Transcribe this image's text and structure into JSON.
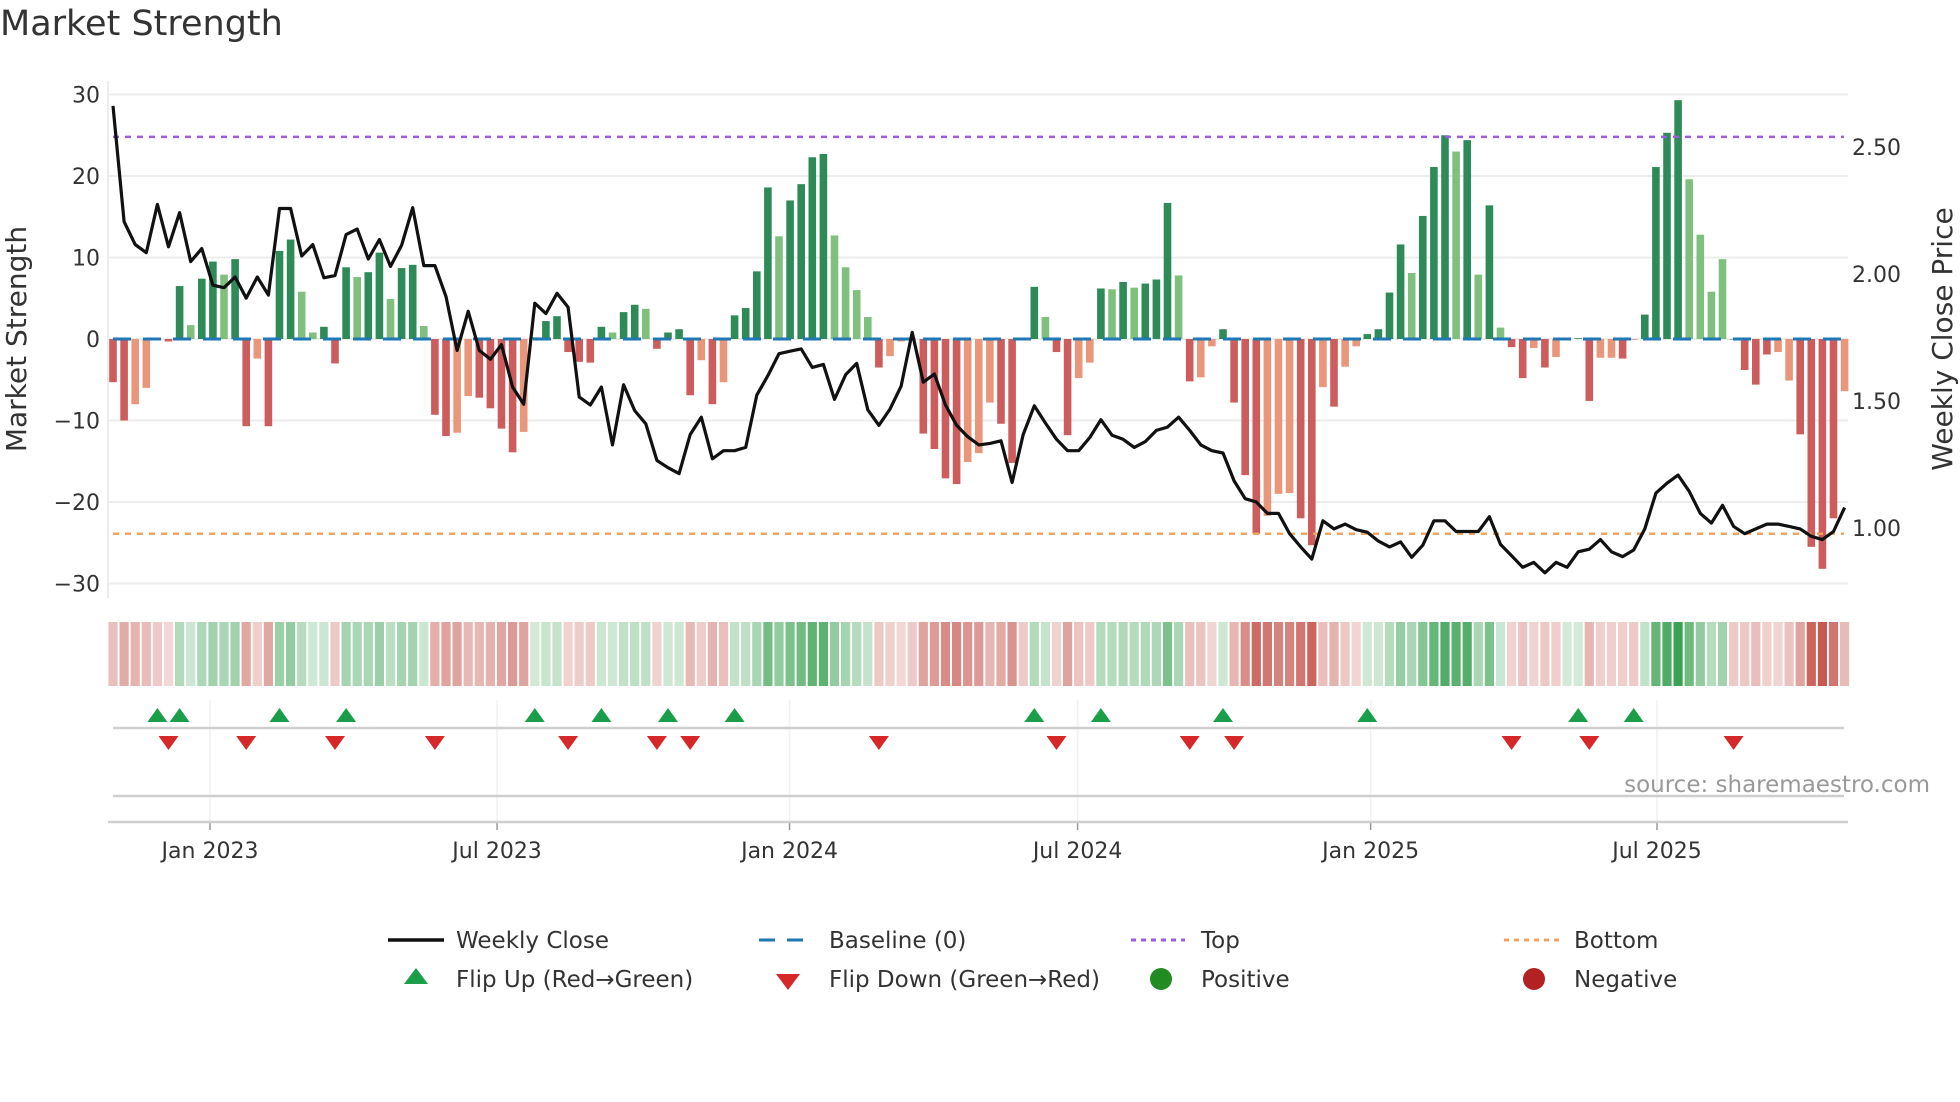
{
  "title": "Market Strength",
  "source": "source: sharemaestro.com",
  "legend": {
    "weekly_close": "Weekly Close",
    "baseline": "Baseline (0)",
    "top": "Top",
    "bottom": "Bottom",
    "flip_up": "Flip Up (Red→Green)",
    "flip_down": "Flip Down (Green→Red)",
    "positive": "Positive",
    "negative": "Negative"
  },
  "colors": {
    "strong_pos": "#2e8b57",
    "weak_pos": "#7fc07f",
    "strong_neg": "#cd5c5c",
    "weak_neg": "#e9967a",
    "price_line": "#111111",
    "baseline": "#1f77b4",
    "top": "#9b5de5",
    "bottom": "#f4a460",
    "flip_up": "#1a9e4a",
    "flip_down": "#d62828",
    "positive_dot": "#228b22",
    "negative_dot": "#b22222"
  },
  "chart_data": {
    "type": "bar+line",
    "title": "Market Strength",
    "ylabel": "Market Strength",
    "y2label": "Weekly Close Price",
    "ylim": [
      -31.5,
      31.5
    ],
    "yticks": [
      "30",
      "20",
      "10",
      "0",
      "−10",
      "−20",
      "−30"
    ],
    "ytick_values": [
      30,
      20,
      10,
      0,
      -10,
      -20,
      -30
    ],
    "y2ticks": [
      "2.50",
      "2.00",
      "1.50",
      "1.00"
    ],
    "y2tick_values": [
      2.5,
      2.0,
      1.5,
      1.0
    ],
    "xticks": [
      "Jan 2023",
      "Jul 2023",
      "Jan 2024",
      "Jul 2024",
      "Jan 2025",
      "Jul 2025"
    ],
    "xtick_week_index": [
      9.74,
      35.6,
      61.95,
      87.9,
      114.3,
      140.1
    ],
    "start_date": "2022-11-01",
    "interval": "weekly",
    "top_level": 24.8,
    "bottom_level": -23.9,
    "baseline": 0,
    "strength": [
      -5.3,
      -10,
      -8,
      -6,
      0,
      -0.3,
      6.5,
      1.7,
      7.4,
      9.5,
      7.9,
      9.8,
      -10.7,
      -2.4,
      -10.7,
      10.8,
      12.2,
      5.8,
      0.8,
      1.5,
      -3,
      8.8,
      7.6,
      8.2,
      10.6,
      4.9,
      8.7,
      9.1,
      1.6,
      -9.3,
      -11.9,
      -11.5,
      -7,
      -7.2,
      -8.5,
      -11,
      -13.9,
      -11.4,
      0.2,
      2.2,
      2.8,
      -1.6,
      -2.8,
      -2.9,
      1.5,
      0.8,
      3.3,
      4.2,
      3.7,
      -1.2,
      0.8,
      1.2,
      -6.9,
      -2.6,
      -8,
      -5.3,
      2.9,
      3.8,
      8.3,
      18.6,
      12.6,
      17,
      19,
      22.3,
      22.7,
      12.7,
      8.8,
      6,
      2.7,
      -3.5,
      -2.1,
      -0.3,
      0,
      -11.6,
      -13.5,
      -17.1,
      -17.8,
      -15.1,
      -14,
      -7.8,
      -10.4,
      -15.2,
      0,
      6.4,
      2.7,
      -1.6,
      -11.8,
      -4.8,
      -2.9,
      6.2,
      6.1,
      7,
      6.3,
      6.8,
      7.3,
      16.7,
      7.8,
      -5.2,
      -4.7,
      -0.9,
      1.2,
      -7.8,
      -16.7,
      -23.9,
      -21.7,
      -19,
      -18.9,
      -22,
      -25.3,
      -5.9,
      -8.3,
      -3.4,
      -0.9,
      0.6,
      1.2,
      5.7,
      11.6,
      8.1,
      15.1,
      21.1,
      25,
      23,
      24.4,
      7.9,
      16.4,
      1.4,
      -1,
      -4.8,
      -1.1,
      -3.5,
      -2.2,
      0.1,
      0.1,
      -7.6,
      -2.3,
      -2.3,
      -2.4,
      0,
      3,
      21.1,
      25.3,
      29.3,
      19.6,
      12.8,
      5.8,
      9.8,
      0,
      -3.8,
      -5.6,
      -1.9,
      -1.6,
      -5.1,
      -11.7,
      -25.5,
      -28.2,
      -22,
      -6.4
    ],
    "strength_class": "RRrrRRGgGGgGRrRGGggGRGgGGgGGgRRrrRRRRrGGGRRRGgGGgRGGRrRrGGGGgGGGGggggRrrRRRRRrrrRRRGgRRrrGgGgGGGgRrrGRRRrrrRRrRrrGGGGgGGGgGgGgRRrRrGGRrrRRGGGGggggGRRRrrRRRRrr",
    "weekly_close": [
      2.662,
      2.206,
      2.116,
      2.084,
      2.274,
      2.107,
      2.242,
      2.049,
      2.1,
      1.956,
      1.946,
      1.988,
      1.905,
      1.988,
      1.917,
      2.258,
      2.258,
      2.071,
      2.116,
      1.985,
      1.994,
      2.155,
      2.177,
      2.059,
      2.136,
      2.03,
      2.113,
      2.261,
      2.033,
      2.033,
      1.911,
      1.699,
      1.853,
      1.699,
      1.664,
      1.722,
      1.555,
      1.487,
      1.885,
      1.844,
      1.924,
      1.869,
      1.516,
      1.484,
      1.555,
      1.327,
      1.564,
      1.462,
      1.41,
      1.266,
      1.237,
      1.214,
      1.368,
      1.436,
      1.272,
      1.304,
      1.304,
      1.317,
      1.523,
      1.6,
      1.686,
      1.696,
      1.705,
      1.632,
      1.644,
      1.506,
      1.603,
      1.648,
      1.465,
      1.404,
      1.468,
      1.558,
      1.77,
      1.574,
      1.606,
      1.484,
      1.404,
      1.359,
      1.327,
      1.333,
      1.343,
      1.179,
      1.368,
      1.481,
      1.413,
      1.349,
      1.304,
      1.304,
      1.356,
      1.426,
      1.365,
      1.349,
      1.317,
      1.34,
      1.384,
      1.397,
      1.436,
      1.384,
      1.327,
      1.304,
      1.295,
      1.185,
      1.115,
      1.102,
      1.057,
      1.057,
      0.977,
      0.925,
      0.877,
      1.028,
      0.996,
      1.015,
      0.993,
      0.983,
      0.948,
      0.925,
      0.945,
      0.884,
      0.932,
      1.028,
      1.028,
      0.986,
      0.986,
      0.986,
      1.044,
      0.935,
      0.89,
      0.845,
      0.864,
      0.823,
      0.864,
      0.845,
      0.906,
      0.916,
      0.954,
      0.906,
      0.887,
      0.913,
      0.996,
      1.137,
      1.176,
      1.208,
      1.144,
      1.057,
      1.019,
      1.089,
      1.006,
      0.977,
      0.996,
      1.015,
      1.015,
      1.006,
      0.996,
      0.967,
      0.954,
      0.986,
      1.08
    ],
    "flip_up_weeks": [
      5,
      7,
      16,
      22,
      39,
      45,
      51,
      57,
      84,
      90,
      101,
      114,
      133,
      138
    ],
    "flip_down_weeks": [
      6,
      13,
      21,
      30,
      42,
      50,
      53,
      70,
      86,
      98,
      102,
      127,
      134,
      147
    ]
  }
}
